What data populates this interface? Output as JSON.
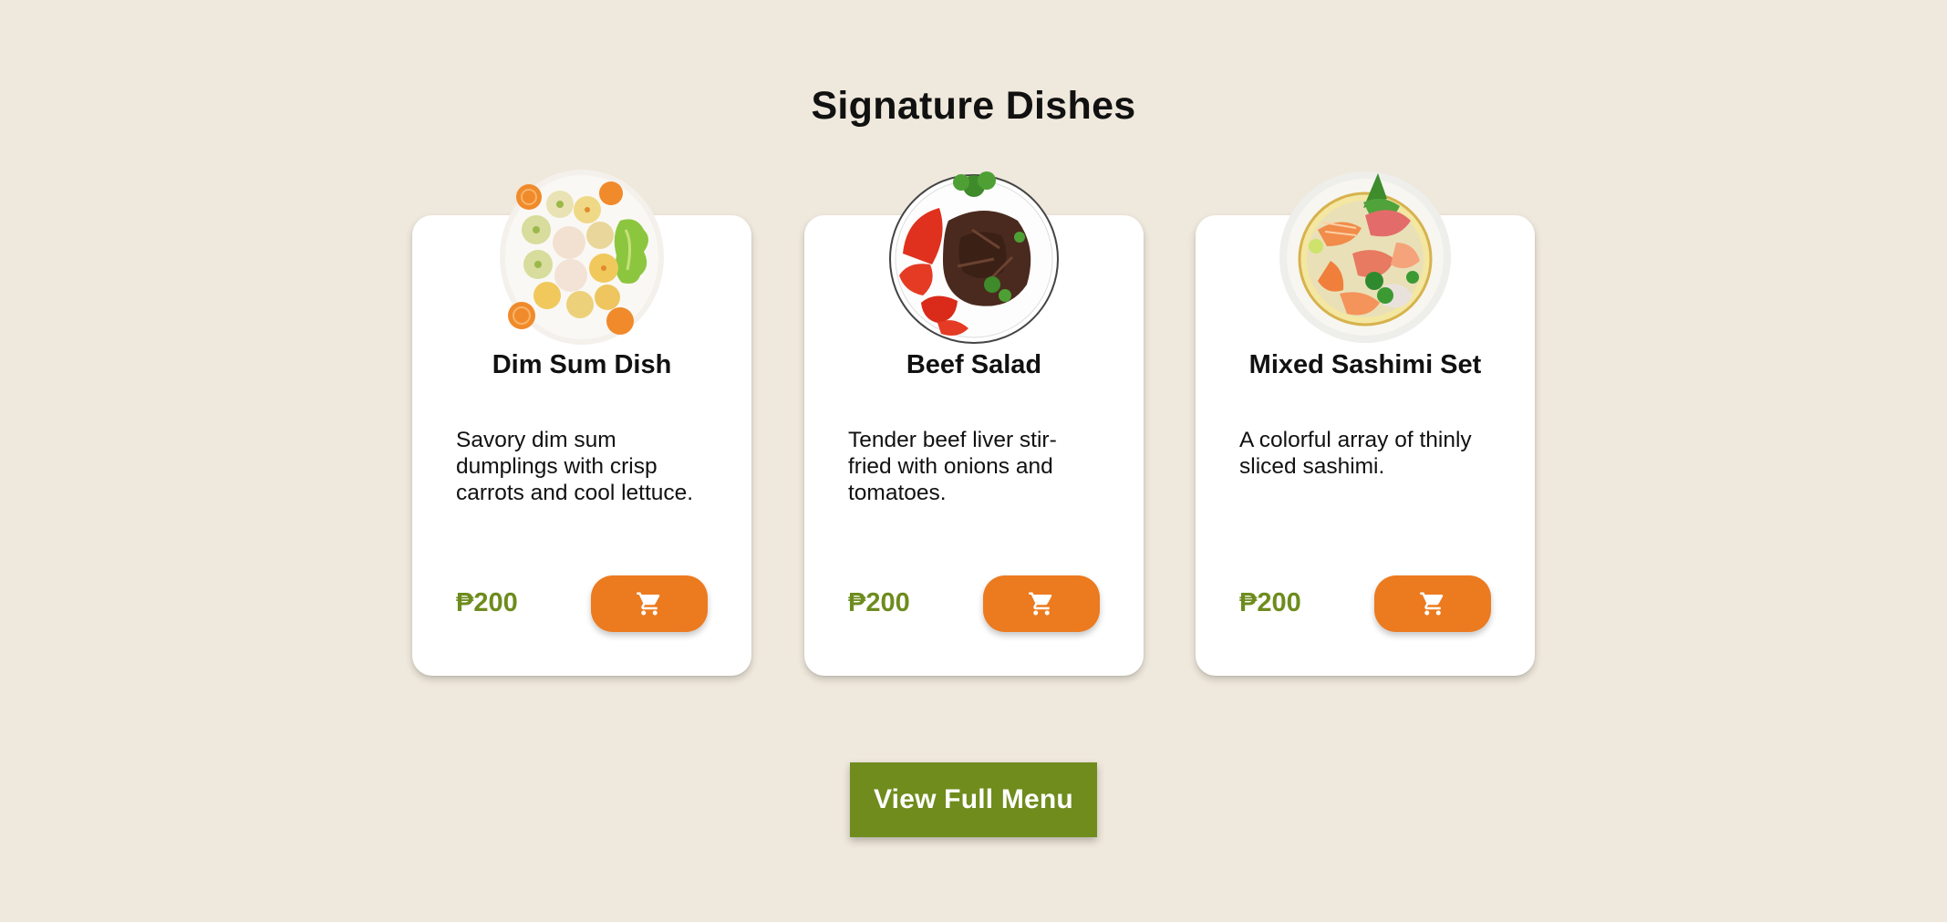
{
  "section": {
    "title": "Signature Dishes"
  },
  "dishes": [
    {
      "name": "Dim Sum Dish",
      "description": "Savory dim sum dumplings with crisp carrots and cool lettuce.",
      "price": "₱200",
      "image_icon": "dim-sum-plate-image",
      "cart_icon": "shopping-cart-icon"
    },
    {
      "name": "Beef Salad",
      "description": "Tender beef liver stir-fried with onions and tomatoes.",
      "price": "₱200",
      "image_icon": "beef-salad-plate-image",
      "cart_icon": "shopping-cart-icon"
    },
    {
      "name": "Mixed Sashimi Set",
      "description": "A colorful array of thinly sliced sashimi.",
      "price": "₱200",
      "image_icon": "sashimi-plate-image",
      "cart_icon": "shopping-cart-icon"
    }
  ],
  "cta": {
    "label": "View Full Menu"
  },
  "colors": {
    "background": "#efe8dc",
    "card": "#ffffff",
    "price": "#6e8c1e",
    "cart_button": "#ec7a1f",
    "menu_button": "#6f8c1d"
  }
}
